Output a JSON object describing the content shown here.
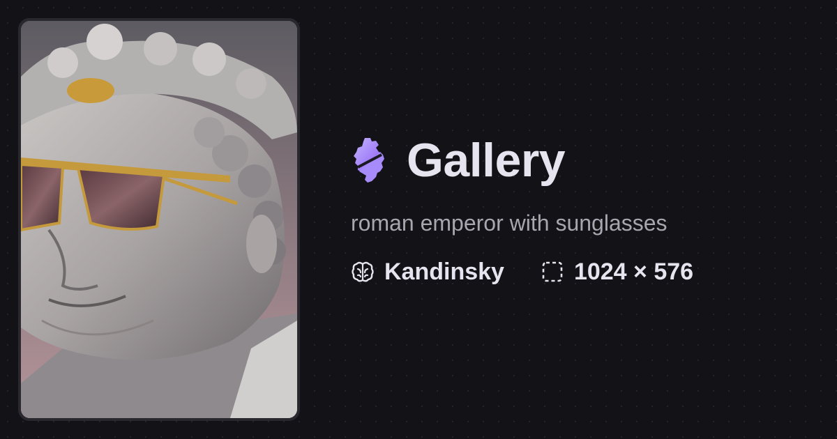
{
  "preview": {
    "alt_icon": "image-thumbnail"
  },
  "header": {
    "logo_icon": "gear-s-logo-icon",
    "title": "Gallery"
  },
  "prompt": "roman emperor with sunglasses",
  "meta": {
    "model_icon": "brain-icon",
    "model": "Kandinsky",
    "size_icon": "dashed-frame-icon",
    "dimensions": "1024 × 576"
  },
  "colors": {
    "background": "#131217",
    "accent": "#a78bfa",
    "title": "#e6e4ee",
    "muted": "#a8a6af"
  }
}
